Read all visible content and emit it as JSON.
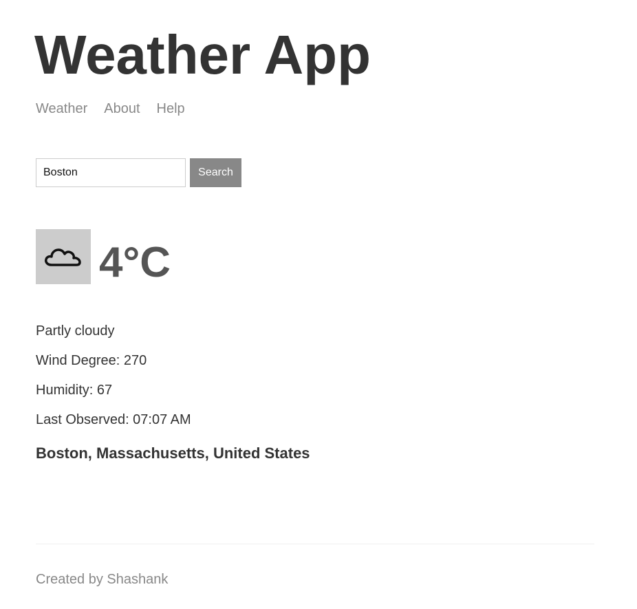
{
  "header": {
    "title": "Weather App"
  },
  "nav": {
    "items": [
      {
        "label": "Weather"
      },
      {
        "label": "About"
      },
      {
        "label": "Help"
      }
    ]
  },
  "search": {
    "value": "Boston",
    "button_label": "Search"
  },
  "weather": {
    "icon": "cloud-icon",
    "temperature": "4°C",
    "description": "Partly cloudy",
    "wind_degree": "Wind Degree: 270",
    "humidity": "Humidity: 67",
    "last_observed": "Last Observed: 07:07 AM",
    "location": "Boston, Massachusetts, United States"
  },
  "footer": {
    "credit": "Created by Shashank"
  },
  "colors": {
    "title": "#333333",
    "nav_link": "#888888",
    "button_bg": "#888888",
    "icon_box_bg": "#cccccc",
    "temperature": "#555555",
    "footer_text": "#888888"
  }
}
